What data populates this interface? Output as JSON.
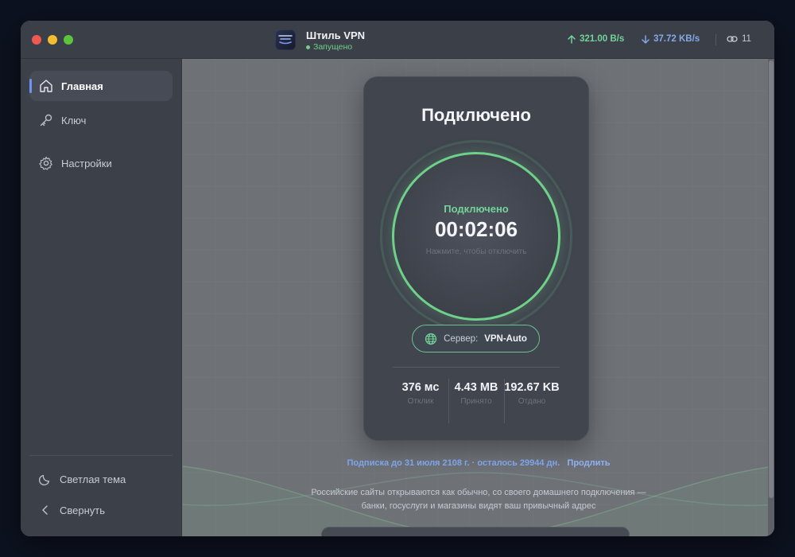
{
  "app": {
    "title": "Штиль VPN",
    "status": "Запущено"
  },
  "header": {
    "upload_rate": "321.00 B/s",
    "download_rate": "37.72 KB/s",
    "connections": "11"
  },
  "sidebar": {
    "items": [
      {
        "label": "Главная",
        "icon": "home-icon",
        "active": true
      },
      {
        "label": "Ключ",
        "icon": "key-icon",
        "active": false
      },
      {
        "label": "Настройки",
        "icon": "gear-icon",
        "active": false
      }
    ],
    "theme_toggle": "Светлая тема",
    "collapse": "Свернуть"
  },
  "card": {
    "title": "Подключено",
    "ring_status": "Подключено",
    "timer": "00:02:06",
    "hint": "Нажмите, чтобы отключить",
    "server_label": "Сервер:",
    "server_value": "VPN-Auto",
    "stats": [
      {
        "value": "376 мс",
        "label": "Отклик"
      },
      {
        "value": "4.43 MB",
        "label": "Принято"
      },
      {
        "value": "192.67 KB",
        "label": "Отдано"
      }
    ]
  },
  "subscription": {
    "text": "Подписка до 31 июля 2108 г. · осталось 29944 дн.",
    "renew": "Продлить"
  },
  "info": {
    "line1": "Российские сайты открываются как обычно, со своего домашнего подключения —",
    "line2": "банки, госуслуги и магазины видят ваш привычный адрес"
  },
  "colors": {
    "accent_green": "#6fd08a",
    "accent_blue": "#7ea4ec",
    "window_bg": "#6e7277",
    "sidebar_bg": "#3b4049",
    "card_bg": "#40454e"
  }
}
